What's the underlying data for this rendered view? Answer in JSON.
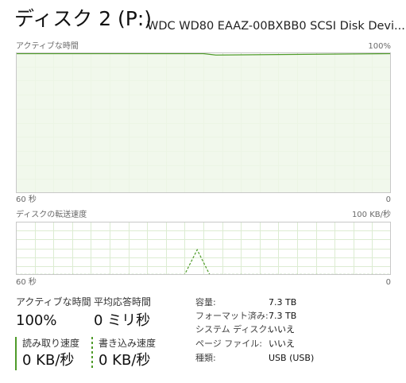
{
  "header": {
    "title": "ディスク 2 (P:)",
    "device": "WDC WD80 EAAZ-00BXBB0 SCSI Disk Devi..."
  },
  "colors": {
    "line": "#4f9b2a",
    "fill": "#eff7e9",
    "grid": "#dcecd2",
    "border": "#c8c8c8"
  },
  "active_chart": {
    "label": "アクティブな時間",
    "max_label": "100%",
    "time_label": "60 秒",
    "min_label": "0"
  },
  "transfer_chart": {
    "label": "ディスクの転送速度",
    "max_label": "100 KB/秒",
    "time_label": "60 秒",
    "min_label": "0"
  },
  "chart_data": [
    {
      "type": "area",
      "title": "アクティブな時間",
      "xlabel": "60 秒",
      "ylim": [
        0,
        100
      ],
      "x": [
        60,
        30,
        28,
        0
      ],
      "series": [
        {
          "values": [
            100,
            100,
            99,
            100
          ]
        }
      ]
    },
    {
      "type": "line",
      "title": "ディスクの転送速度",
      "xlabel": "60 秒",
      "ylim": [
        0,
        100
      ],
      "x": [
        60,
        33,
        31,
        29,
        0
      ],
      "series": [
        {
          "values": [
            0,
            0,
            48,
            0,
            0
          ]
        }
      ]
    }
  ],
  "stats": {
    "active_time_label": "アクティブな時間",
    "active_time_value": "100%",
    "avg_response_label": "平均応答時間",
    "avg_response_value": "0 ミリ秒",
    "read_label": "読み取り速度",
    "read_value": "0 KB/秒",
    "write_label": "書き込み速度",
    "write_value": "0 KB/秒"
  },
  "properties": [
    {
      "label": "容量:",
      "value": "7.3 TB"
    },
    {
      "label": "フォーマット済み:",
      "value": "7.3 TB"
    },
    {
      "label": "システム ディスク:",
      "value": "いいえ"
    },
    {
      "label": "ページ ファイル:",
      "value": "いいえ"
    },
    {
      "label": "種類:",
      "value": "USB (USB)"
    }
  ]
}
